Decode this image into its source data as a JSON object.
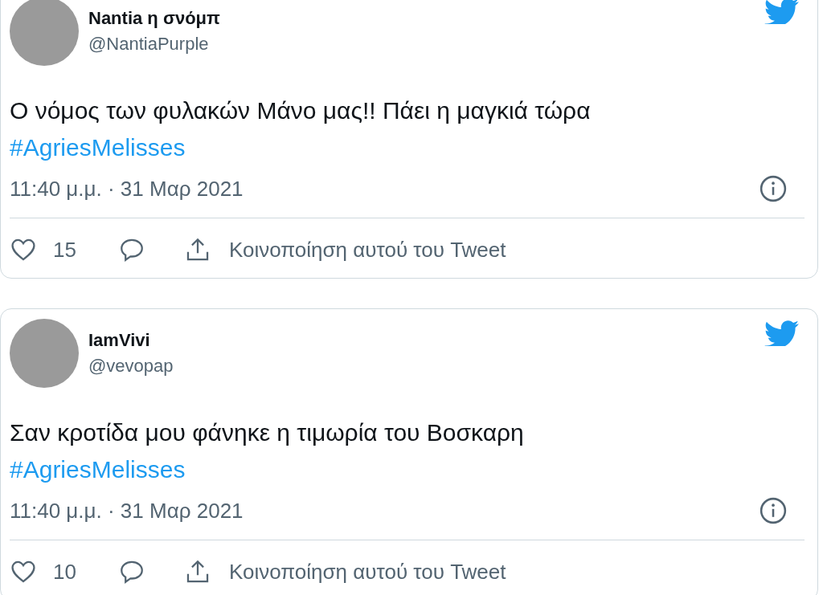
{
  "tweets": [
    {
      "name": "Nantia η σνόμπ",
      "handle": "@NantiaPurple",
      "text": "Ο νόμος των φυλακών Μάνο μας!! Πάει η μαγκιά τώρα",
      "hashtag": "#AgriesMelisses",
      "timestamp": "11:40 μ.μ. · 31 Μαρ 2021",
      "likes": "15",
      "share_label": "Κοινοποίηση αυτού του Tweet"
    },
    {
      "name": "IamVivi",
      "handle": "@vevopap",
      "text": "Σαν κροτίδα μου φάνηκε η τιμωρία του Βοσκαρη",
      "hashtag": "#AgriesMelisses",
      "timestamp": "11:40 μ.μ. · 31 Μαρ 2021",
      "likes": "10",
      "share_label": "Κοινοποίηση αυτού του Tweet"
    }
  ]
}
